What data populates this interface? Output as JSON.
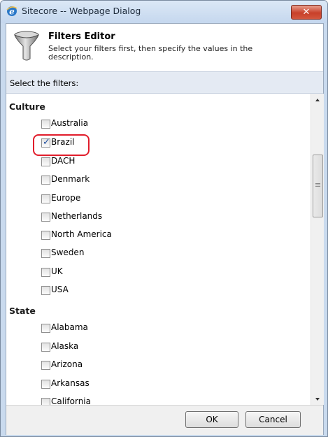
{
  "window": {
    "title": "Sitecore -- Webpage Dialog",
    "close_label": "✕"
  },
  "header": {
    "title": "Filters Editor",
    "description": "Select your filters first, then specify the values in the description."
  },
  "subbar": {
    "label": "Select the filters:"
  },
  "groups": [
    {
      "heading": "Culture",
      "items": [
        {
          "label": "Australia",
          "checked": false
        },
        {
          "label": "Brazil",
          "checked": true
        },
        {
          "label": "DACH",
          "checked": false
        },
        {
          "label": "Denmark",
          "checked": false
        },
        {
          "label": "Europe",
          "checked": false
        },
        {
          "label": "Netherlands",
          "checked": false
        },
        {
          "label": "North America",
          "checked": false
        },
        {
          "label": "Sweden",
          "checked": false
        },
        {
          "label": "UK",
          "checked": false
        },
        {
          "label": "USA",
          "checked": false
        }
      ]
    },
    {
      "heading": "State",
      "items": [
        {
          "label": "Alabama",
          "checked": false
        },
        {
          "label": "Alaska",
          "checked": false
        },
        {
          "label": "Arizona",
          "checked": false
        },
        {
          "label": "Arkansas",
          "checked": false
        },
        {
          "label": "California",
          "checked": false
        }
      ]
    }
  ],
  "buttons": {
    "ok": "OK",
    "cancel": "Cancel"
  },
  "colors": {
    "highlight": "#e11d2b",
    "titlebar": "#c9daee",
    "close": "#c8402a"
  }
}
